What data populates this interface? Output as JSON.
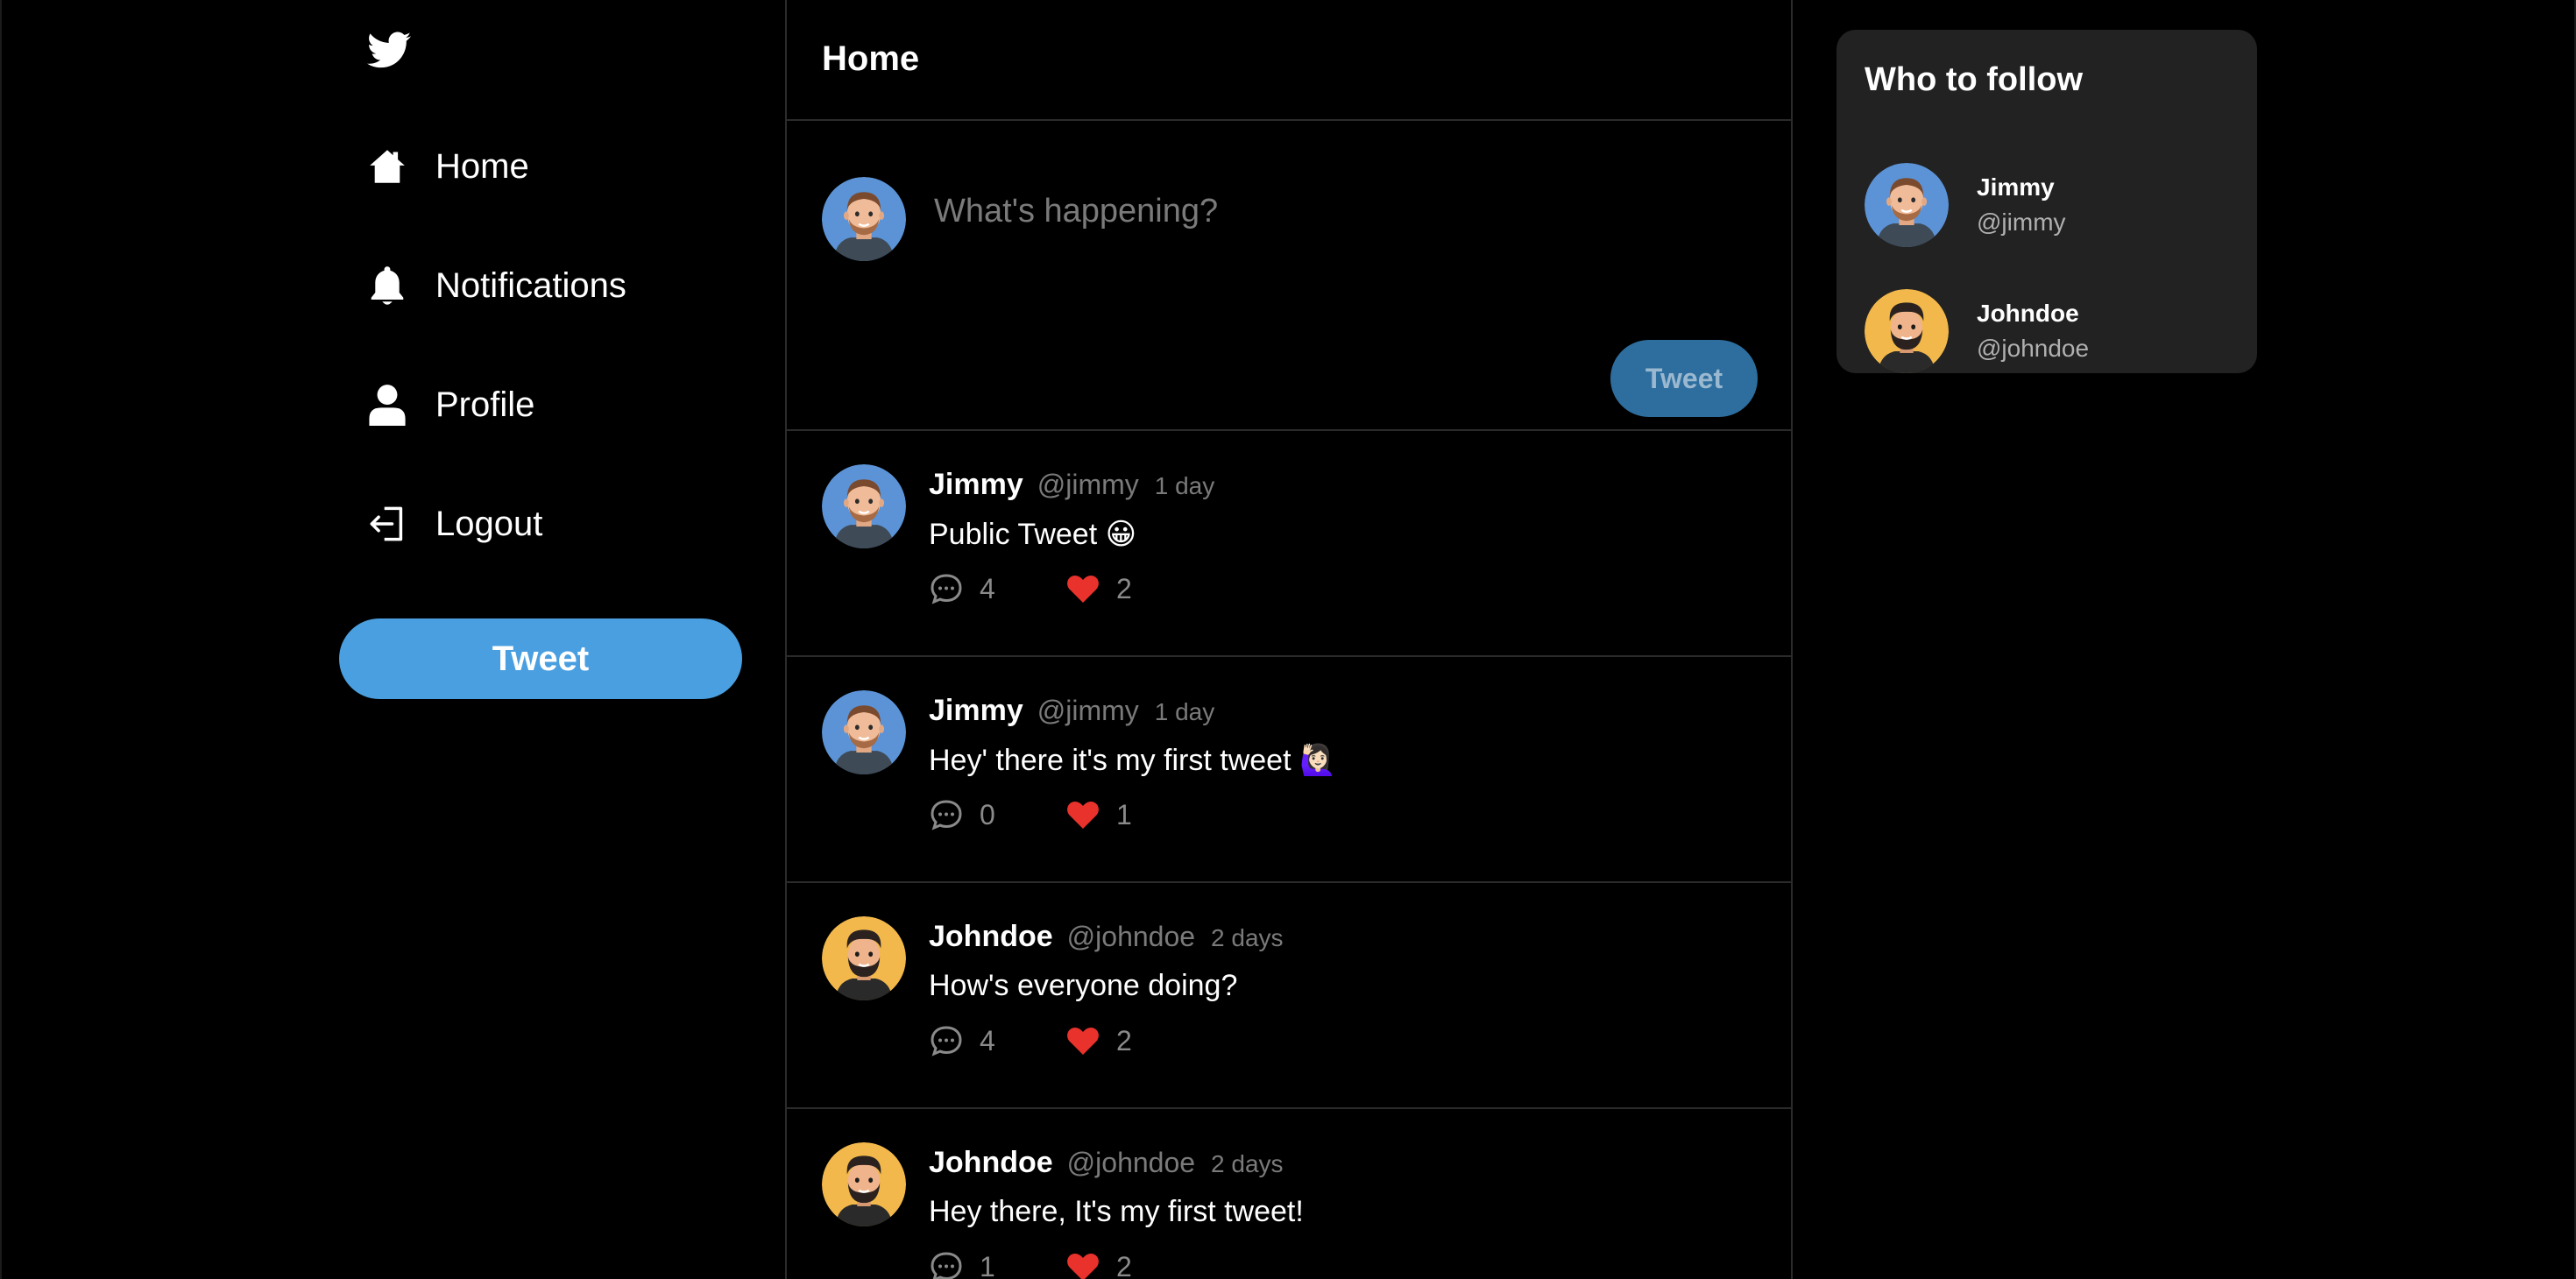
{
  "colors": {
    "background": "#000000",
    "accent": "#4a9fe0",
    "composer_button": "#2d6e9e",
    "like": "#e8322b",
    "card": "#222222"
  },
  "sidebar": {
    "logo_icon": "twitter-bird-icon",
    "items": [
      {
        "label": "Home",
        "icon": "home-icon"
      },
      {
        "label": "Notifications",
        "icon": "bell-icon"
      },
      {
        "label": "Profile",
        "icon": "user-icon"
      },
      {
        "label": "Logout",
        "icon": "logout-icon"
      }
    ],
    "tweet_button_label": "Tweet"
  },
  "main": {
    "title": "Home",
    "composer": {
      "placeholder": "What's happening?",
      "tweet_button_label": "Tweet"
    },
    "tweets": [
      {
        "name": "Jimmy",
        "handle": "@jimmy",
        "time": "1 day",
        "text": "Public Tweet 😀",
        "replies": "4",
        "likes": "2",
        "avatar": "jimmy"
      },
      {
        "name": "Jimmy",
        "handle": "@jimmy",
        "time": "1 day",
        "text": "Hey' there it's my first tweet 🙋🏻‍♀️",
        "replies": "0",
        "likes": "1",
        "avatar": "jimmy"
      },
      {
        "name": "Johndoe",
        "handle": "@johndoe",
        "time": "2 days",
        "text": "How's everyone doing?",
        "replies": "4",
        "likes": "2",
        "avatar": "johndoe"
      },
      {
        "name": "Johndoe",
        "handle": "@johndoe",
        "time": "2 days",
        "text": "Hey there, It's my first tweet!",
        "replies": "1",
        "likes": "2",
        "avatar": "johndoe"
      }
    ]
  },
  "right": {
    "title": "Who to follow",
    "suggestions": [
      {
        "name": "Jimmy",
        "handle": "@jimmy",
        "avatar": "jimmy"
      },
      {
        "name": "Johndoe",
        "handle": "@johndoe",
        "avatar": "johndoe"
      }
    ]
  }
}
